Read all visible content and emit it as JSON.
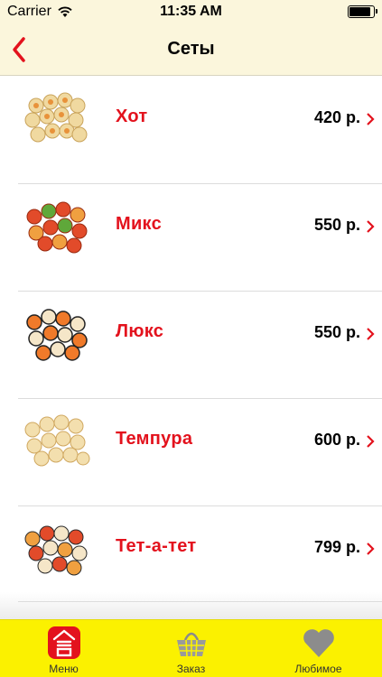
{
  "status_bar": {
    "carrier": "Carrier",
    "time": "11:35 AM",
    "battery_level": 0.9
  },
  "nav": {
    "title": "Сеты",
    "back_icon": "chevron-left-icon"
  },
  "items": [
    {
      "name": "Хот",
      "price": "420 р."
    },
    {
      "name": "Микс",
      "price": "550 р."
    },
    {
      "name": "Люкс",
      "price": "550 р."
    },
    {
      "name": "Темпура",
      "price": "600 р."
    },
    {
      "name": "Тет-а-тет",
      "price": "799 р."
    }
  ],
  "tabs": [
    {
      "label": "Меню",
      "icon": "menu-icon",
      "active": true
    },
    {
      "label": "Заказ",
      "icon": "basket-icon",
      "active": false
    },
    {
      "label": "Любимое",
      "icon": "heart-icon",
      "active": false
    }
  ],
  "colors": {
    "accent": "#e3121d",
    "tab_bar": "#fbf100",
    "header": "#fbf6dc"
  }
}
